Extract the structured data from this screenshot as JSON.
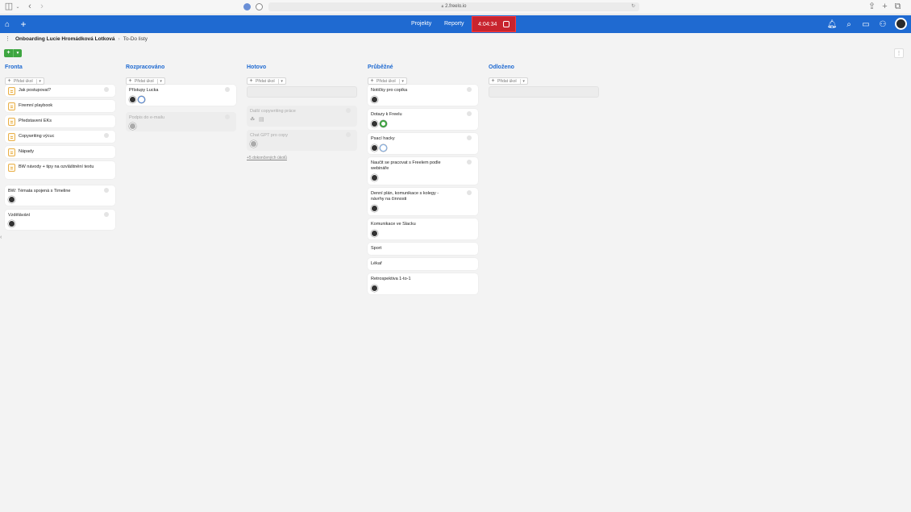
{
  "browser": {
    "url": "2.freelo.io",
    "icons": [
      "sidebar-icon",
      "chevron-down-icon",
      "back-icon",
      "forward-icon",
      "share-icon",
      "new-tab-icon",
      "tabs-icon"
    ]
  },
  "header": {
    "nav": [
      "Projekty",
      "Reporty"
    ],
    "timer": "4:04:34",
    "accent": "#1f6ad1",
    "timer_color": "#c8242e"
  },
  "breadcrumb": {
    "project": "Onboarding Lucie Hromádková Lotková",
    "separator": "›",
    "list": "To-Do listy"
  },
  "add_label": "Přidat úkol",
  "columns": [
    {
      "title": "Fronta",
      "cards": [
        {
          "title": "Jak postupovat?"
        },
        {
          "title": "Firemní playbook"
        },
        {
          "title": "Představení EKs"
        },
        {
          "title": "Copywriting výcuc"
        },
        {
          "title": "Nápady"
        },
        {
          "title": "BW návody + tipy na ozvláštnění textu"
        },
        {
          "title": "BW: Témata spojená s Timeline"
        },
        {
          "title": "Vzdělávání"
        }
      ]
    },
    {
      "title": "Rozpracováno",
      "cards": [
        {
          "title": "Přístupy Lucka"
        },
        {
          "title": "Podpis do e-mailu"
        }
      ]
    },
    {
      "title": "Hotovo",
      "cards": [
        {
          "title": "Další copywriting práce"
        },
        {
          "title": "Chat GPT pro copy"
        }
      ],
      "more": "+5 dokončených úkolů"
    },
    {
      "title": "Průběžné",
      "cards": [
        {
          "title": "Notičky pro copíka"
        },
        {
          "title": "Dotazy k Freelu"
        },
        {
          "title": "Psací hacky"
        },
        {
          "title": "Naučit se pracovat s Freelem podle webináře"
        },
        {
          "title": "Denní plán, komunikace s kolegy - návrhy na činnosti"
        },
        {
          "title": "Komunikace ve Slacku"
        },
        {
          "title": "Sport"
        },
        {
          "title": "Lékař"
        },
        {
          "title": "Retrospektiva 1-to-1"
        }
      ]
    },
    {
      "title": "Odloženo",
      "cards": []
    }
  ]
}
